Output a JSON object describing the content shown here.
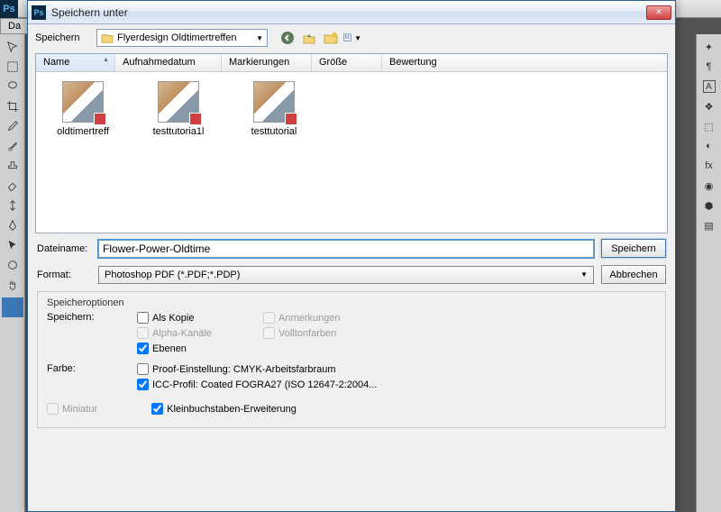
{
  "app": {
    "logo": "Ps",
    "tab": "Da"
  },
  "dialog": {
    "title": "Speichern unter",
    "location_label": "Speichern",
    "folder": "Flyerdesign Oldtimertreffen",
    "columns": {
      "name": "Name",
      "date": "Aufnahmedatum",
      "tags": "Markierungen",
      "size": "Größe",
      "rating": "Bewertung"
    },
    "files": [
      "oldtimertreff",
      "testtutoria1l",
      "testtutorial"
    ],
    "filename_label": "Dateiname:",
    "filename": "Flower-Power-Oldtime",
    "format_label": "Format:",
    "format": "Photoshop PDF (*.PDF;*.PDP)",
    "save_btn": "Speichern",
    "cancel_btn": "Abbrechen",
    "options": {
      "legend": "Speicheroptionen",
      "save_label": "Speichern:",
      "as_copy": "Als Kopie",
      "annotations": "Anmerkungen",
      "alpha": "Alpha-Kanäle",
      "spot": "Volltonfarben",
      "layers": "Ebenen",
      "color_label": "Farbe:",
      "proof": "Proof-Einstellung: CMYK-Arbeitsfarbraum",
      "icc": "ICC-Profil: Coated FOGRA27 (ISO 12647-2:2004...",
      "thumb": "Miniatur",
      "lowercase": "Kleinbuchstaben-Erweiterung"
    }
  }
}
